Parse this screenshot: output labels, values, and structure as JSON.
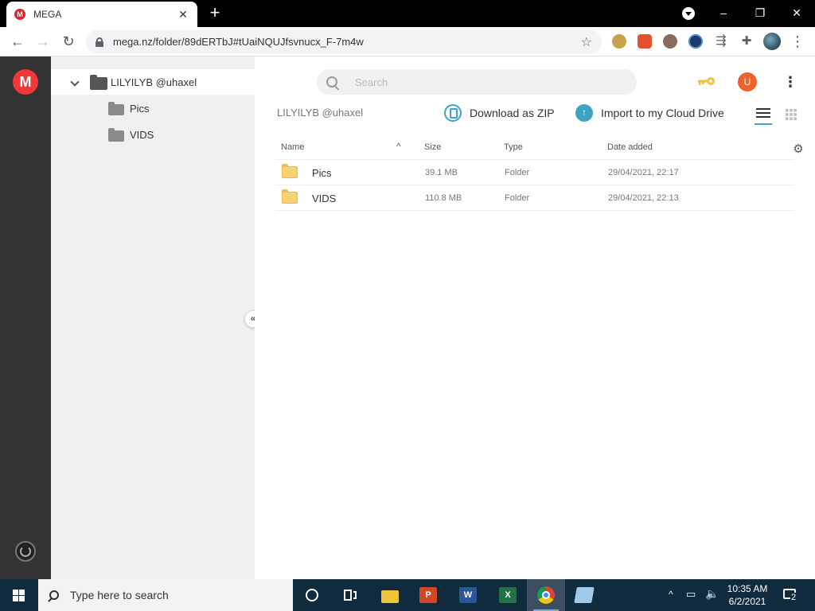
{
  "browser": {
    "tab_title": "MEGA",
    "tab_favicon": "M",
    "new_tab": "+",
    "url": "mega.nz/folder/89dERTbJ#tUaiNQUJfsvnucx_F-7m4w",
    "window_controls": {
      "minimize": "–",
      "restore": "❐",
      "close": "✕"
    }
  },
  "mega": {
    "logo": "M",
    "tree": {
      "root_label": "LILYILYB @uhaxel",
      "children": [
        {
          "label": "Pics"
        },
        {
          "label": "VIDS"
        }
      ]
    },
    "search_placeholder": "Search",
    "avatar_letter": "U",
    "breadcrumb": "LILYILYB @uhaxel",
    "actions": {
      "download_zip": "Download as ZIP",
      "import": "Import to my Cloud Drive"
    },
    "columns": {
      "name": "Name",
      "size": "Size",
      "type": "Type",
      "date": "Date added"
    },
    "files": [
      {
        "name": "Pics",
        "size": "39.1 MB",
        "type": "Folder",
        "date": "29/04/2021, 22:17"
      },
      {
        "name": "VIDS",
        "size": "110.8 MB",
        "type": "Folder",
        "date": "29/04/2021, 22:13"
      }
    ],
    "colors": {
      "brand": "#f0373a",
      "accent": "#3fa3c4",
      "avatar": "#f0622d",
      "key": "#f2c23d"
    }
  },
  "taskbar": {
    "search_placeholder": "Type here to search",
    "apps": [
      "task-view",
      "file-explorer",
      "powerpoint",
      "word",
      "excel",
      "chrome",
      "notepad"
    ],
    "time": "10:35 AM",
    "date": "6/2/2021",
    "notification_count": "2"
  }
}
